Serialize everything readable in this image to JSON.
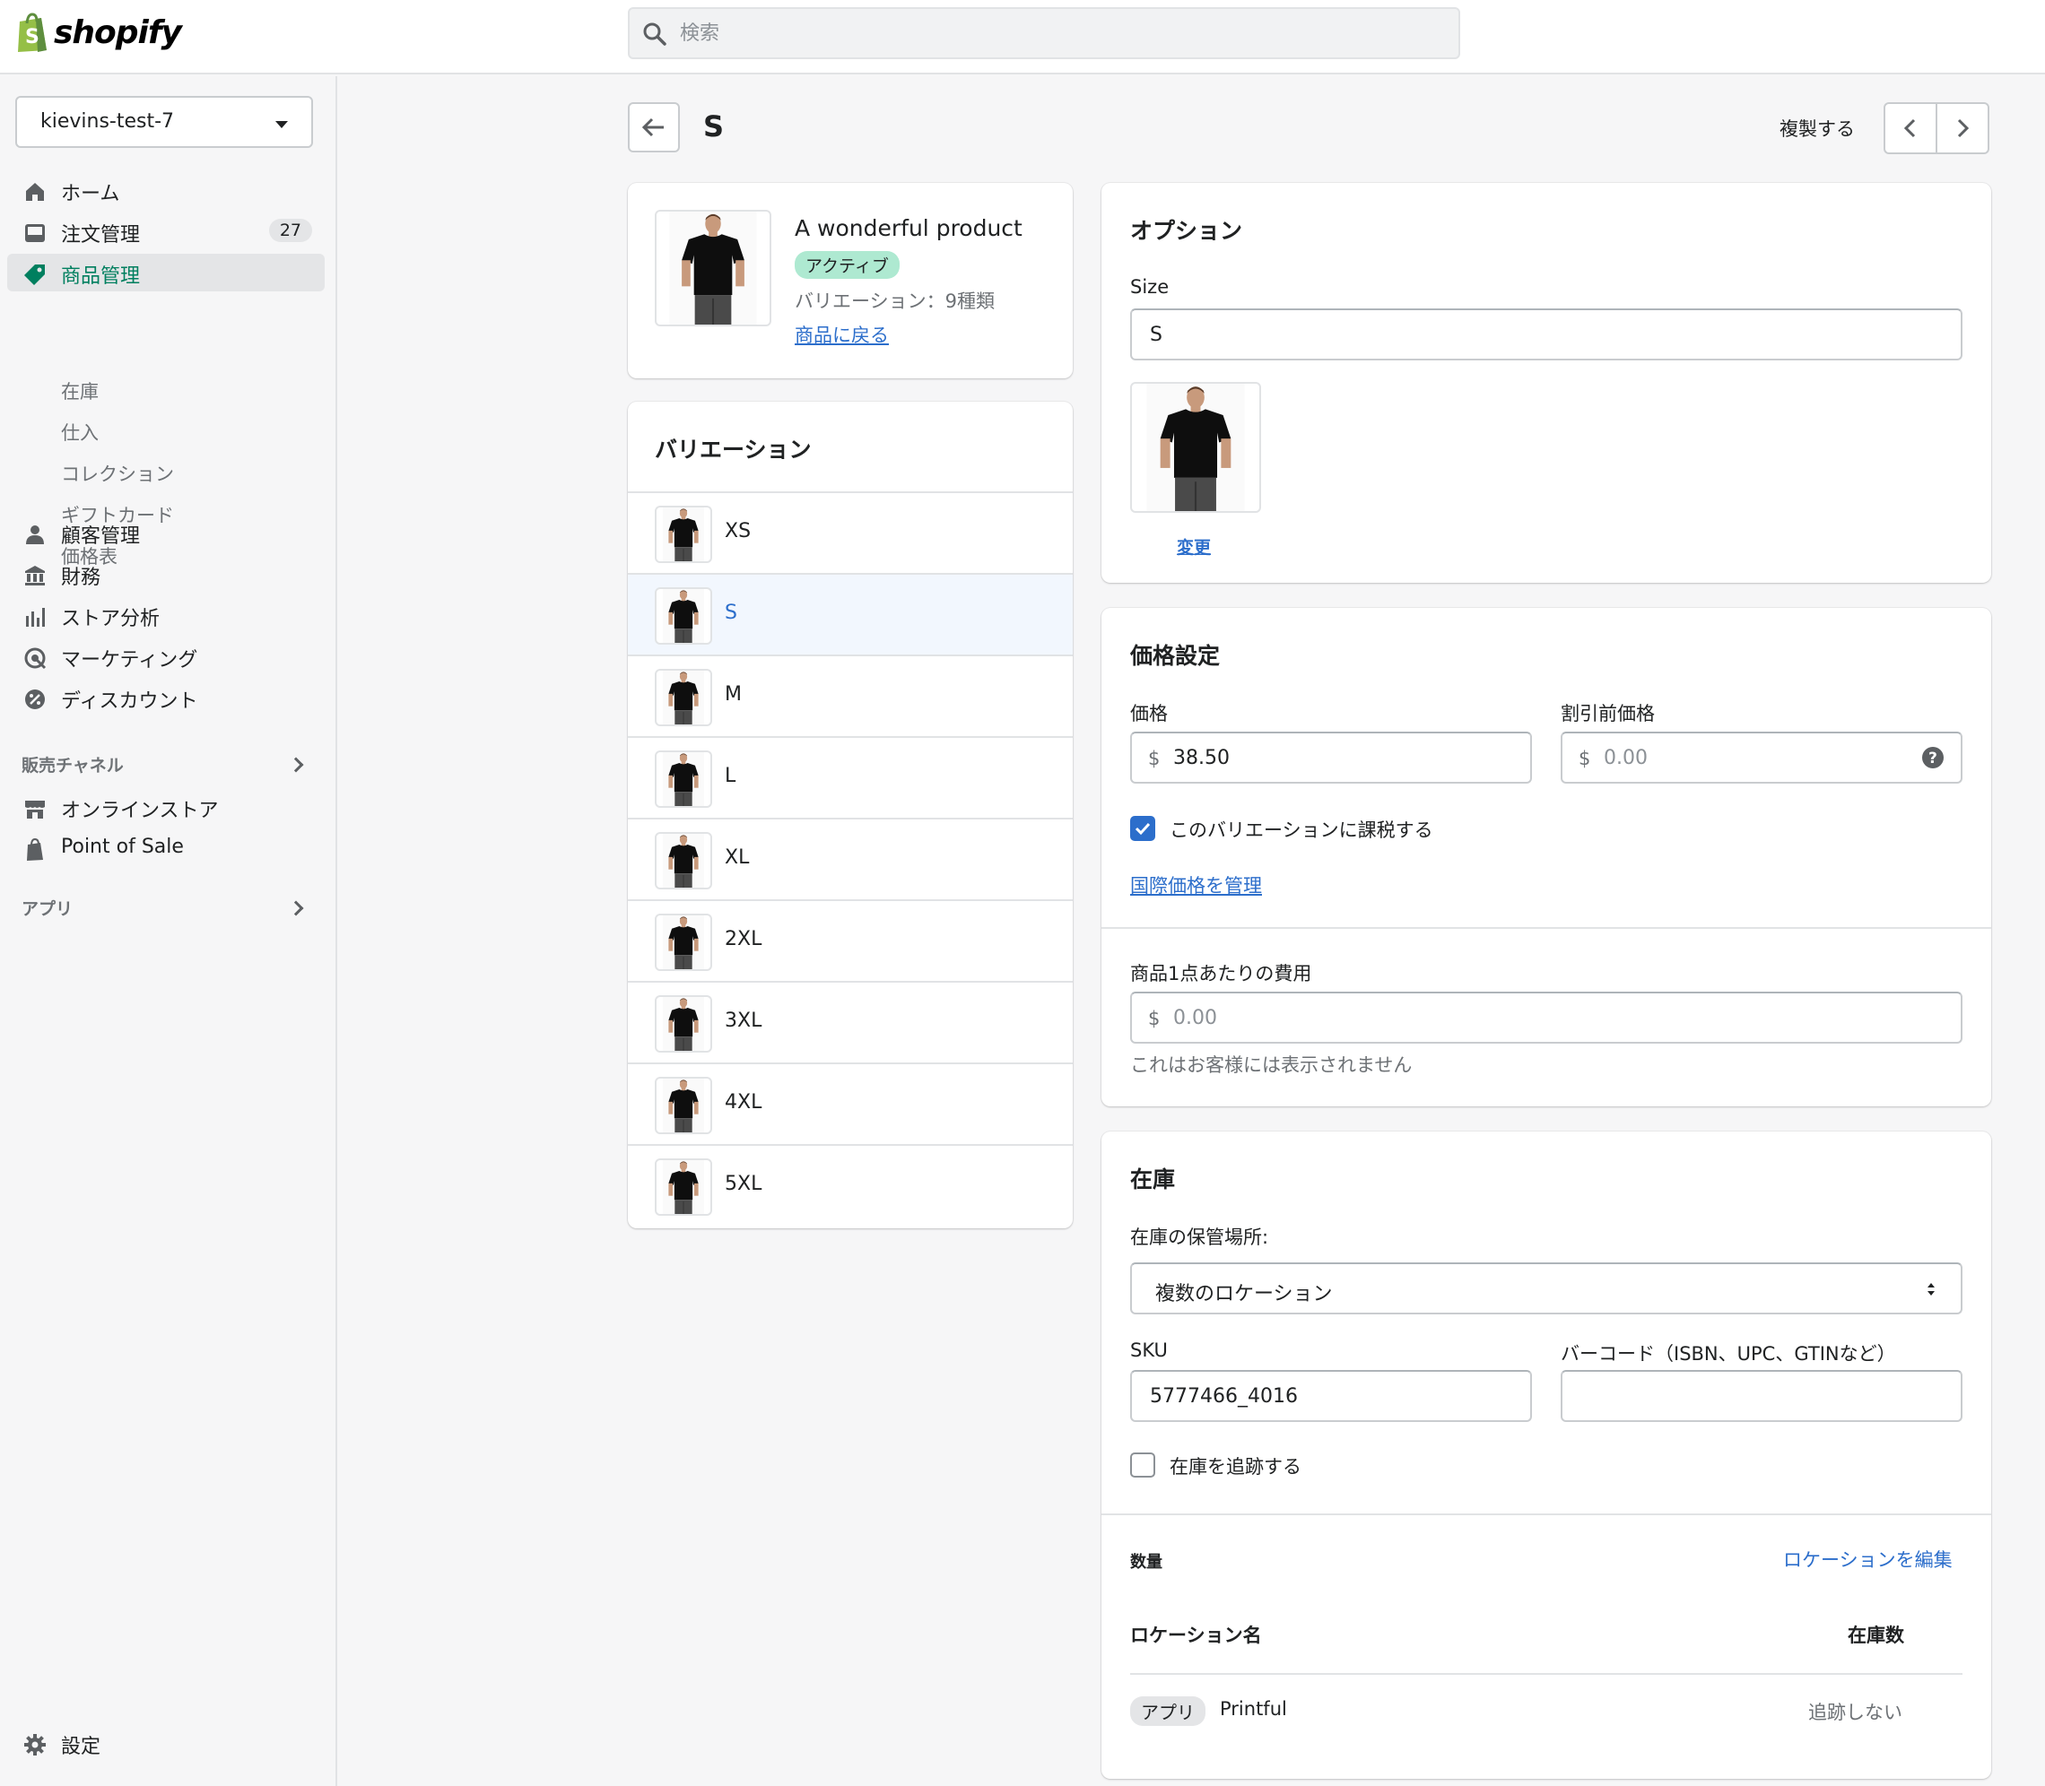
{
  "header": {
    "logo_text": "shopify",
    "search_placeholder": "検索"
  },
  "sidebar": {
    "store_name": "kievins-test-7",
    "items": [
      {
        "label": "ホーム",
        "icon": "home-icon"
      },
      {
        "label": "注文管理",
        "icon": "inbox-icon",
        "badge": "27"
      },
      {
        "label": "商品管理",
        "icon": "tag-icon"
      },
      {
        "label": "顧客管理",
        "icon": "person-icon"
      },
      {
        "label": "財務",
        "icon": "bank-icon"
      },
      {
        "label": "ストア分析",
        "icon": "bar-chart-icon"
      },
      {
        "label": "マーケティング",
        "icon": "target-icon"
      },
      {
        "label": "ディスカウント",
        "icon": "discount-icon"
      }
    ],
    "product_sub": [
      "在庫",
      "仕入",
      "コレクション",
      "ギフトカード",
      "価格表"
    ],
    "sales_channels_title": "販売チャネル",
    "channels": [
      {
        "label": "オンラインストア",
        "icon": "store-icon"
      },
      {
        "label": "Point of Sale",
        "icon": "pos-bag-icon"
      }
    ],
    "apps_title": "アプリ",
    "settings": "設定"
  },
  "page": {
    "title": "S",
    "duplicate": "複製する"
  },
  "product": {
    "name": "A wonderful product",
    "status": "アクティブ",
    "variant_count": "バリエーション：9種類",
    "back_link": "商品に戻る"
  },
  "variants": {
    "title": "バリエーション",
    "items": [
      "XS",
      "S",
      "M",
      "L",
      "XL",
      "2XL",
      "3XL",
      "4XL",
      "5XL"
    ],
    "selected": "S"
  },
  "options": {
    "title": "オプション",
    "size_label": "Size",
    "size_value": "S",
    "change_link": "変更"
  },
  "pricing": {
    "title": "価格設定",
    "price_label": "価格",
    "currency": "$",
    "price_value": "38.50",
    "compare_label": "割引前価格",
    "compare_value": "0.00",
    "tax_label": "このバリエーションに課税する",
    "tax_checked": true,
    "intl_link": "国際価格を管理",
    "cost_label": "商品1点あたりの費用",
    "cost_value": "0.00",
    "cost_help": "これはお客様には表示されません"
  },
  "inventory": {
    "title": "在庫",
    "location_label": "在庫の保管場所:",
    "location_value": "複数のロケーション",
    "sku_label": "SKU",
    "sku_value": "5777466_4016",
    "barcode_label": "バーコード（ISBN、UPC、GTINなど）",
    "barcode_value": "",
    "track_label": "在庫を追跡する",
    "track_checked": false,
    "quantity_title": "数量",
    "edit_locations": "ロケーションを編集",
    "col_location": "ロケーション名",
    "col_stock": "在庫数",
    "rows": [
      {
        "tag": "アプリ",
        "name": "Printful",
        "stock": "追跡しない"
      }
    ]
  },
  "colors": {
    "accent": "#2c6ecb",
    "active_nav": "#007f5f",
    "status_bg": "#aee9d1",
    "shopify_green": "#95bf47"
  }
}
